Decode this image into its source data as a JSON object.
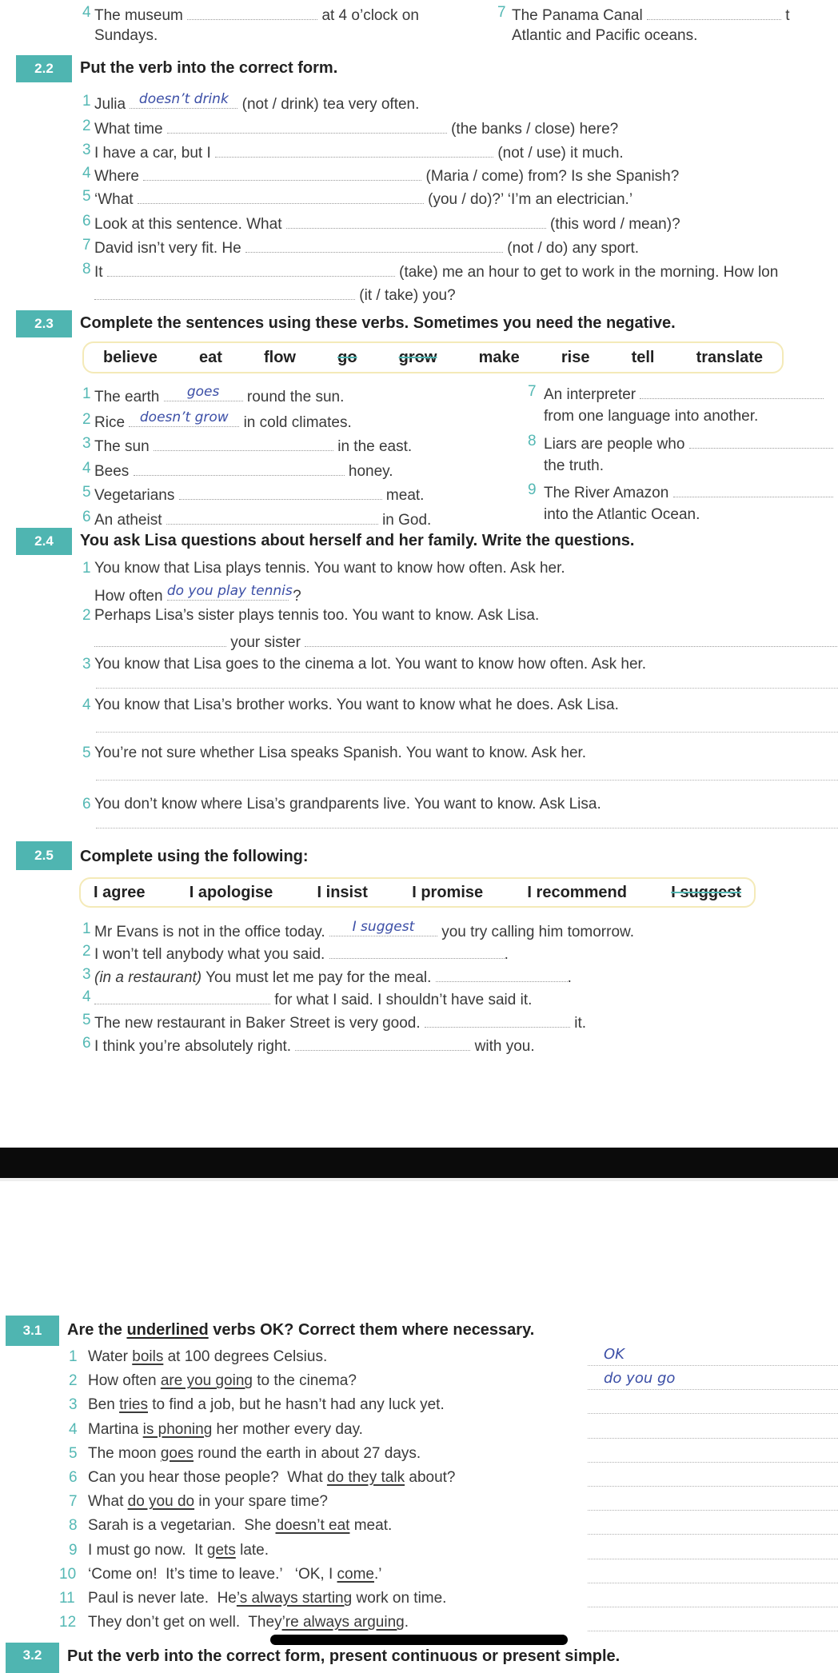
{
  "prev": {
    "i4_num": "4",
    "i4_a": "The museum",
    "i4_b": "at 4 o’clock on",
    "i4_c": "Sundays.",
    "i7_num": "7",
    "i7_a": "The Panama Canal",
    "i7_b": "t",
    "i7_c": "Atlantic and Pacific oceans."
  },
  "s22": {
    "num": "2.2",
    "title": "Put the verb into the correct form.",
    "items": [
      {
        "n": "1",
        "a": "Julia",
        "ans": "doesn’t drink",
        "b": "(not / drink) tea very often."
      },
      {
        "n": "2",
        "a": "What time",
        "b": "(the banks / close) here?"
      },
      {
        "n": "3",
        "a": "I have a car, but I",
        "b": "(not / use) it much."
      },
      {
        "n": "4",
        "a": "Where",
        "b": "(Maria / come) from?  Is she Spanish?"
      },
      {
        "n": "5",
        "a": "‘What",
        "b": "(you / do)?’   ‘I’m an electrician.’"
      },
      {
        "n": "6",
        "a": "Look at this sentence. What",
        "b": "(this word / mean)?"
      },
      {
        "n": "7",
        "a": "David isn’t very fit.  He",
        "b": "(not / do) any sport."
      },
      {
        "n": "8",
        "a": "It",
        "b": "(take) me an hour to get to work in the morning.  How lon",
        "c": "(it / take) you?"
      }
    ]
  },
  "s23": {
    "num": "2.3",
    "title": "Complete the sentences using these verbs.  Sometimes you need the negative.",
    "verbs": [
      "believe",
      "eat",
      "flow",
      "go",
      "grow",
      "make",
      "rise",
      "tell",
      "translate"
    ],
    "used_verbs": [
      "go",
      "grow"
    ],
    "items": [
      {
        "n": "1",
        "a": "The earth",
        "ans": "goes",
        "b": "round the sun."
      },
      {
        "n": "2",
        "a": "Rice",
        "ans": "doesn’t grow",
        "b": "in cold climates."
      },
      {
        "n": "3",
        "a": "The sun",
        "b": "in the east."
      },
      {
        "n": "4",
        "a": "Bees",
        "b": "honey."
      },
      {
        "n": "5",
        "a": "Vegetarians",
        "b": "meat."
      },
      {
        "n": "6",
        "a": "An atheist",
        "b": "in God."
      },
      {
        "n": "7",
        "a": "An interpreter",
        "c": "from one language into another."
      },
      {
        "n": "8",
        "a": "Liars are people who",
        "c": "the truth."
      },
      {
        "n": "9",
        "a": "The River Amazon",
        "c": "into the Atlantic Ocean."
      }
    ]
  },
  "s24": {
    "num": "2.4",
    "title": "You ask Lisa questions about herself and her family.  Write the questions.",
    "items": [
      {
        "n": "1",
        "a": "You know that Lisa plays tennis.  You want to know how often.  Ask her.",
        "q": "How often",
        "ans": "do you play tennis",
        "end": "?"
      },
      {
        "n": "2",
        "a": "Perhaps Lisa’s sister plays tennis too.  You want to know.  Ask Lisa.",
        "mid": "your sister"
      },
      {
        "n": "3",
        "a": "You know that Lisa goes to the cinema a lot.  You want to know how often.  Ask her."
      },
      {
        "n": "4",
        "a": "You know that Lisa’s brother works.  You want to know what he does.  Ask Lisa."
      },
      {
        "n": "5",
        "a": "You’re not sure whether Lisa speaks Spanish.  You want to know.  Ask her."
      },
      {
        "n": "6",
        "a": "You don’t know where Lisa’s grandparents live.  You want to know.  Ask Lisa."
      }
    ]
  },
  "s25": {
    "num": "2.5",
    "title": "Complete using the following:",
    "phrases": [
      "I agree",
      "I apologise",
      "I insist",
      "I promise",
      "I recommend",
      "I suggest"
    ],
    "used_phrases": [
      "I suggest"
    ],
    "items": [
      {
        "n": "1",
        "a": "Mr Evans is not in the office today.",
        "ans": "I suggest",
        "b": "you try calling him tomorrow."
      },
      {
        "n": "2",
        "a": "I won’t tell anybody what you said.",
        "b": "."
      },
      {
        "n": "3",
        "it": "(in a restaurant)",
        "a": "You must let me pay for the meal.",
        "b": "."
      },
      {
        "n": "4",
        "b": "for what I said.  I shouldn’t have said it."
      },
      {
        "n": "5",
        "a": "The new restaurant in Baker Street is very good.",
        "b": "it."
      },
      {
        "n": "6",
        "a": "I think you’re absolutely right.",
        "b": "with you."
      }
    ]
  },
  "s31": {
    "num": "3.1",
    "t1": "Are the ",
    "tu": "underlined",
    "t2": " verbs OK?  Correct them where necessary.",
    "items": [
      {
        "n": "1",
        "a": "Water ",
        "u": "boils",
        "b": " at 100 degrees Celsius.",
        "ans": "OK"
      },
      {
        "n": "2",
        "a": "How often ",
        "u": "are you going",
        "b": " to the cinema?",
        "ans": "do you go"
      },
      {
        "n": "3",
        "a": "Ben ",
        "u": "tries",
        "b": " to find a job, but he hasn’t had any luck yet."
      },
      {
        "n": "4",
        "a": "Martina ",
        "u": "is phoning",
        "b": " her mother every day."
      },
      {
        "n": "5",
        "a": "The moon ",
        "u": "goes",
        "b": " round the earth in about 27 days."
      },
      {
        "n": "6",
        "a": "Can you hear those people?  What ",
        "u": "do they talk",
        "b": " about?"
      },
      {
        "n": "7",
        "a": "What ",
        "u": "do you do",
        "b": " in your spare time?"
      },
      {
        "n": "8",
        "a": "Sarah is a vegetarian.  She ",
        "u": "doesn’t eat",
        "b": " meat."
      },
      {
        "n": "9",
        "a": "I must go now.  It ",
        "u": "gets",
        "b": " late."
      },
      {
        "n": "10",
        "a": "‘Come on!  It’s time to leave.’   ‘OK, I ",
        "u": "come",
        "b": ".’"
      },
      {
        "n": "11",
        "a": "Paul is never late.  He",
        "u": "’s always starting",
        "b": " work on time."
      },
      {
        "n": "12",
        "a": "They don’t get on well.  They",
        "u": "’re always arguing",
        "b": "."
      }
    ]
  },
  "s32": {
    "num": "3.2",
    "title": "Put the verb into the correct form, present continuous or present simple."
  },
  "colors": {
    "accent": "#4fb5b1",
    "handwriting": "#3b4ea6",
    "word_box_border": "#f4eab8"
  }
}
